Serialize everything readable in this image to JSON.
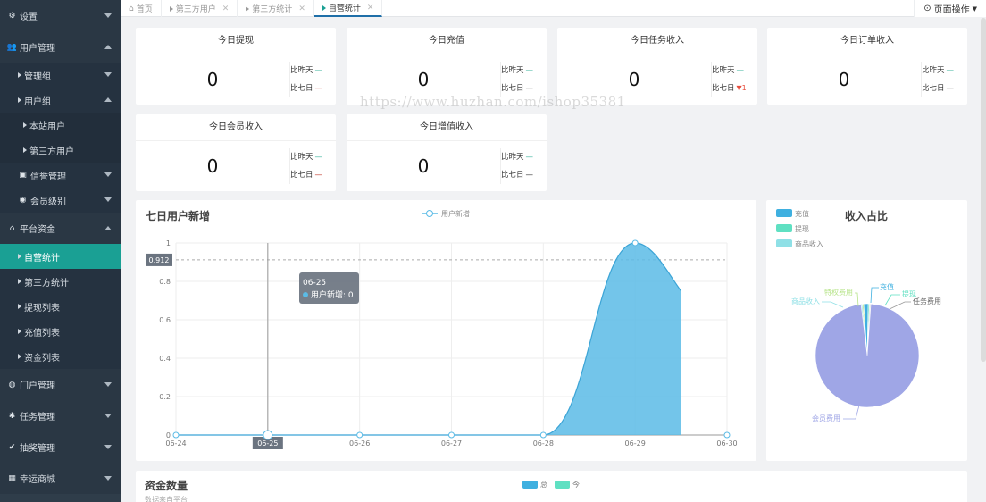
{
  "sidebar": {
    "items": [
      {
        "label": "设置",
        "level": "top",
        "icon": "gears-icon",
        "glyph": "⚙",
        "arrow": "down"
      },
      {
        "label": "用户管理",
        "level": "top",
        "icon": "users-icon",
        "glyph": "👥",
        "arrow": "up"
      },
      {
        "label": "管理组",
        "level": "sub",
        "arrow": "down"
      },
      {
        "label": "用户组",
        "level": "sub",
        "arrow": "up"
      },
      {
        "label": "本站用户",
        "level": "sub2"
      },
      {
        "label": "第三方用户",
        "level": "sub2"
      },
      {
        "label": "信誉管理",
        "level": "sub",
        "icon": "id-card-icon",
        "glyph": "▣",
        "arrow": "down"
      },
      {
        "label": "会员级别",
        "level": "sub",
        "icon": "user-circle-icon",
        "glyph": "◉",
        "arrow": "down"
      },
      {
        "label": "平台资金",
        "level": "top",
        "icon": "bank-icon",
        "glyph": "⌂",
        "arrow": "up"
      },
      {
        "label": "自营统计",
        "level": "sub",
        "active": true
      },
      {
        "label": "第三方统计",
        "level": "sub"
      },
      {
        "label": "提现列表",
        "level": "sub"
      },
      {
        "label": "充值列表",
        "level": "sub"
      },
      {
        "label": "资金列表",
        "level": "sub"
      },
      {
        "label": "门户管理",
        "level": "top",
        "icon": "globe-icon",
        "glyph": "◍",
        "arrow": "down"
      },
      {
        "label": "任务管理",
        "level": "top",
        "icon": "tasks-icon",
        "glyph": "✱",
        "arrow": "down"
      },
      {
        "label": "抽奖管理",
        "level": "top",
        "icon": "check-circle-icon",
        "glyph": "✔",
        "arrow": "down"
      },
      {
        "label": "幸运商城",
        "level": "top",
        "icon": "shop-icon",
        "glyph": "▦",
        "arrow": "down"
      }
    ]
  },
  "tabs": [
    {
      "label": "首页",
      "icon": "home-icon",
      "closable": false
    },
    {
      "label": "第三方用户",
      "closable": true
    },
    {
      "label": "第三方统计",
      "closable": true
    },
    {
      "label": "自营统计",
      "closable": true,
      "active": true
    }
  ],
  "page_ops": {
    "label": "页面操作"
  },
  "stats": [
    {
      "title": "今日提现",
      "value": "0",
      "yesterday_label": "比昨天",
      "yesterday": "—",
      "week_label": "比七日",
      "week": "—",
      "week_color": "red"
    },
    {
      "title": "今日充值",
      "value": "0",
      "yesterday_label": "比昨天",
      "yesterday": "—",
      "week_label": "比七日",
      "week": "—",
      "week_color": "dark"
    },
    {
      "title": "今日任务收入",
      "value": "0",
      "yesterday_label": "比昨天",
      "yesterday": "—",
      "week_label": "比七日",
      "week": "▼1",
      "week_color": "down"
    },
    {
      "title": "今日订单收入",
      "value": "0",
      "yesterday_label": "比昨天",
      "yesterday": "—",
      "week_label": "比七日",
      "week": "—",
      "week_color": "dark"
    },
    {
      "title": "今日会员收入",
      "value": "0",
      "yesterday_label": "比昨天",
      "yesterday": "—",
      "week_label": "比七日",
      "week": "—",
      "week_color": "red"
    },
    {
      "title": "今日增值收入",
      "value": "0",
      "yesterday_label": "比昨天",
      "yesterday": "—",
      "week_label": "比七日",
      "week": "—",
      "week_color": "dark"
    }
  ],
  "watermark": "https://www.huzhan.com/ishop35381",
  "chart_data": [
    {
      "type": "area",
      "title": "七日用户新增",
      "series": [
        {
          "name": "用户新增",
          "values": [
            0,
            0,
            0,
            0,
            0,
            1,
            0.75
          ]
        }
      ],
      "categories": [
        "06-24",
        "06-25",
        "06-26",
        "06-27",
        "06-28",
        "06-29",
        "06-30"
      ],
      "x_values": [
        0,
        1,
        2,
        3,
        4,
        5,
        5.5
      ],
      "ylim": [
        0,
        1
      ],
      "yticks": [
        "0",
        "0.2",
        "0.4",
        "0.6",
        "0.8",
        "1"
      ],
      "grid": true,
      "legend": "top-center",
      "color": "#5bbbe6",
      "pointer": {
        "y": "0.912",
        "x_label": "06-25"
      },
      "tooltip": {
        "title": "06-25",
        "series": "用户新增",
        "value": "0"
      }
    },
    {
      "type": "pie",
      "title": "收入占比",
      "legend": "top-left",
      "legend_items": [
        {
          "name": "充值",
          "color": "#3fb0e0"
        },
        {
          "name": "提现",
          "color": "#5fe0c2"
        },
        {
          "name": "商品收入",
          "color": "#8fe0e6"
        }
      ],
      "slices": [
        {
          "name": "会员费用",
          "value": 96,
          "color": "#9fa6e6"
        },
        {
          "name": "商品收入",
          "value": 0.4,
          "color": "#8fe0e6"
        },
        {
          "name": "特权费用",
          "value": 0.4,
          "color": "#b7e48a"
        },
        {
          "name": "充值",
          "value": 1.4,
          "color": "#3fb0e0"
        },
        {
          "name": "提现",
          "value": 0.4,
          "color": "#5fe0c2"
        },
        {
          "name": "任务费用",
          "value": 0.4,
          "color": "#d9d9d9"
        }
      ]
    },
    {
      "type": "bar",
      "title": "资金数量",
      "subtitle": "数据来自平台",
      "legend": "top-center",
      "series": [
        {
          "name": "总",
          "color": "#3fb0e0"
        },
        {
          "name": "今",
          "color": "#5fe0c2"
        }
      ]
    }
  ]
}
